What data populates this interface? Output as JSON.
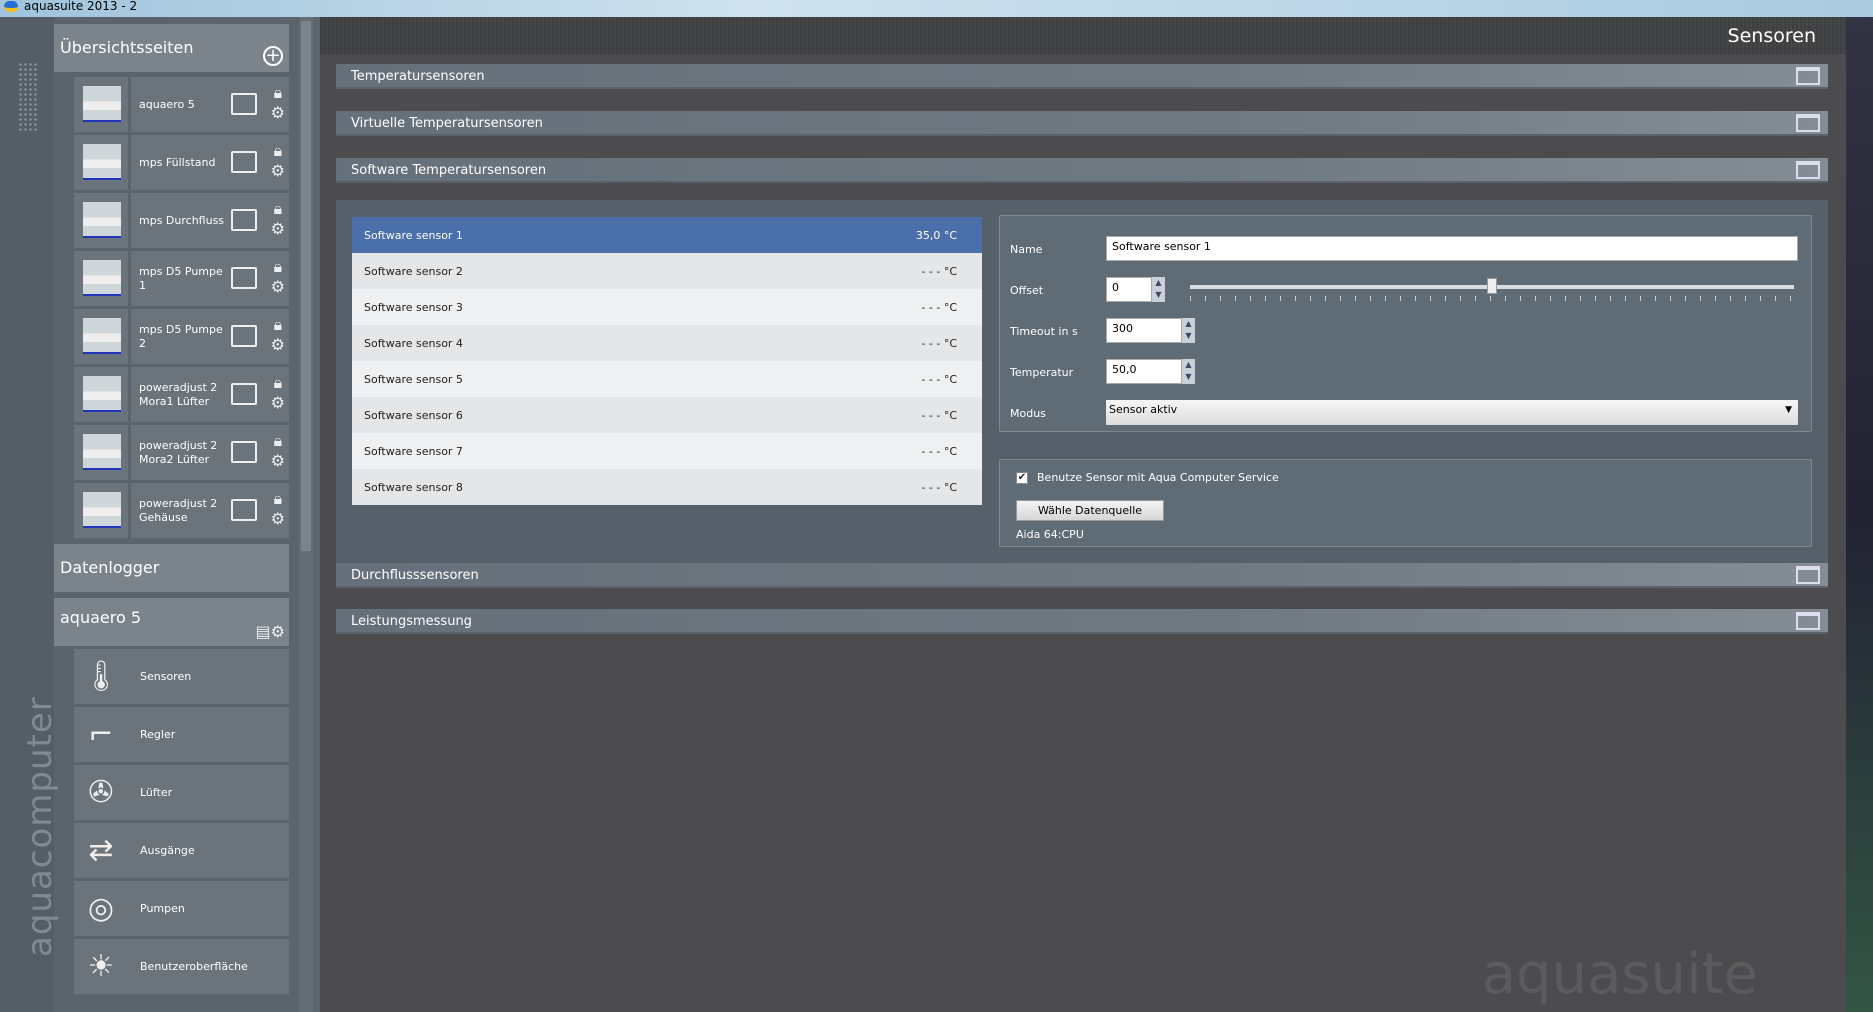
{
  "window": {
    "title": "aquasuite 2013 - 2"
  },
  "sidebar": {
    "brand": "aquacomputer",
    "overview_header": "Übersichtsseiten",
    "pages": [
      {
        "label": "aquaero 5"
      },
      {
        "label": "mps Füllstand"
      },
      {
        "label": "mps Durchfluss"
      },
      {
        "label": "mps D5 Pumpe 1"
      },
      {
        "label": "mps D5 Pumpe 2"
      },
      {
        "label": "poweradjust 2 Mora1 Lüfter"
      },
      {
        "label": "poweradjust 2 Mora2 Lüfter"
      },
      {
        "label": "poweradjust 2 Gehäuse"
      }
    ],
    "datalogger_header": "Datenlogger",
    "device_header": "aquaero 5",
    "device_items": [
      {
        "label": "Sensoren",
        "icon": "thermometer-icon"
      },
      {
        "label": "Regler",
        "icon": "controller-icon"
      },
      {
        "label": "Lüfter",
        "icon": "fan-icon"
      },
      {
        "label": "Ausgänge",
        "icon": "outputs-icon"
      },
      {
        "label": "Pumpen",
        "icon": "pump-icon"
      },
      {
        "label": "Benutzeroberfläche",
        "icon": "brightness-icon"
      }
    ]
  },
  "main": {
    "title": "Sensoren",
    "sections": [
      "Temperatursensoren",
      "Virtuelle Temperatursensoren",
      "Software Temperatursensoren",
      "Durchflusssensoren",
      "Leistungsmessung"
    ],
    "sensors": [
      {
        "name": "Software sensor 1",
        "value": "35,0 °C"
      },
      {
        "name": "Software sensor 2",
        "value": "- - - °C"
      },
      {
        "name": "Software sensor 3",
        "value": "- - - °C"
      },
      {
        "name": "Software sensor 4",
        "value": "- - - °C"
      },
      {
        "name": "Software sensor 5",
        "value": "- - - °C"
      },
      {
        "name": "Software sensor 6",
        "value": "- - - °C"
      },
      {
        "name": "Software sensor 7",
        "value": "- - - °C"
      },
      {
        "name": "Software sensor 8",
        "value": "- - - °C"
      }
    ],
    "form": {
      "name_label": "Name",
      "name_value": "Software sensor 1",
      "offset_label": "Offset",
      "offset_value": "0",
      "offset_slider_fraction": 0.5,
      "timeout_label": "Timeout in s",
      "timeout_value": "300",
      "temp_label": "Temperatur",
      "temp_value": "50,0",
      "mode_label": "Modus",
      "mode_value": "Sensor aktiv"
    },
    "service": {
      "checkbox_label": "Benutze Sensor mit Aqua Computer Service",
      "checked": true,
      "button_label": "Wähle Datenquelle",
      "source": "Aida 64:CPU"
    },
    "watermark": "aquasuite"
  }
}
